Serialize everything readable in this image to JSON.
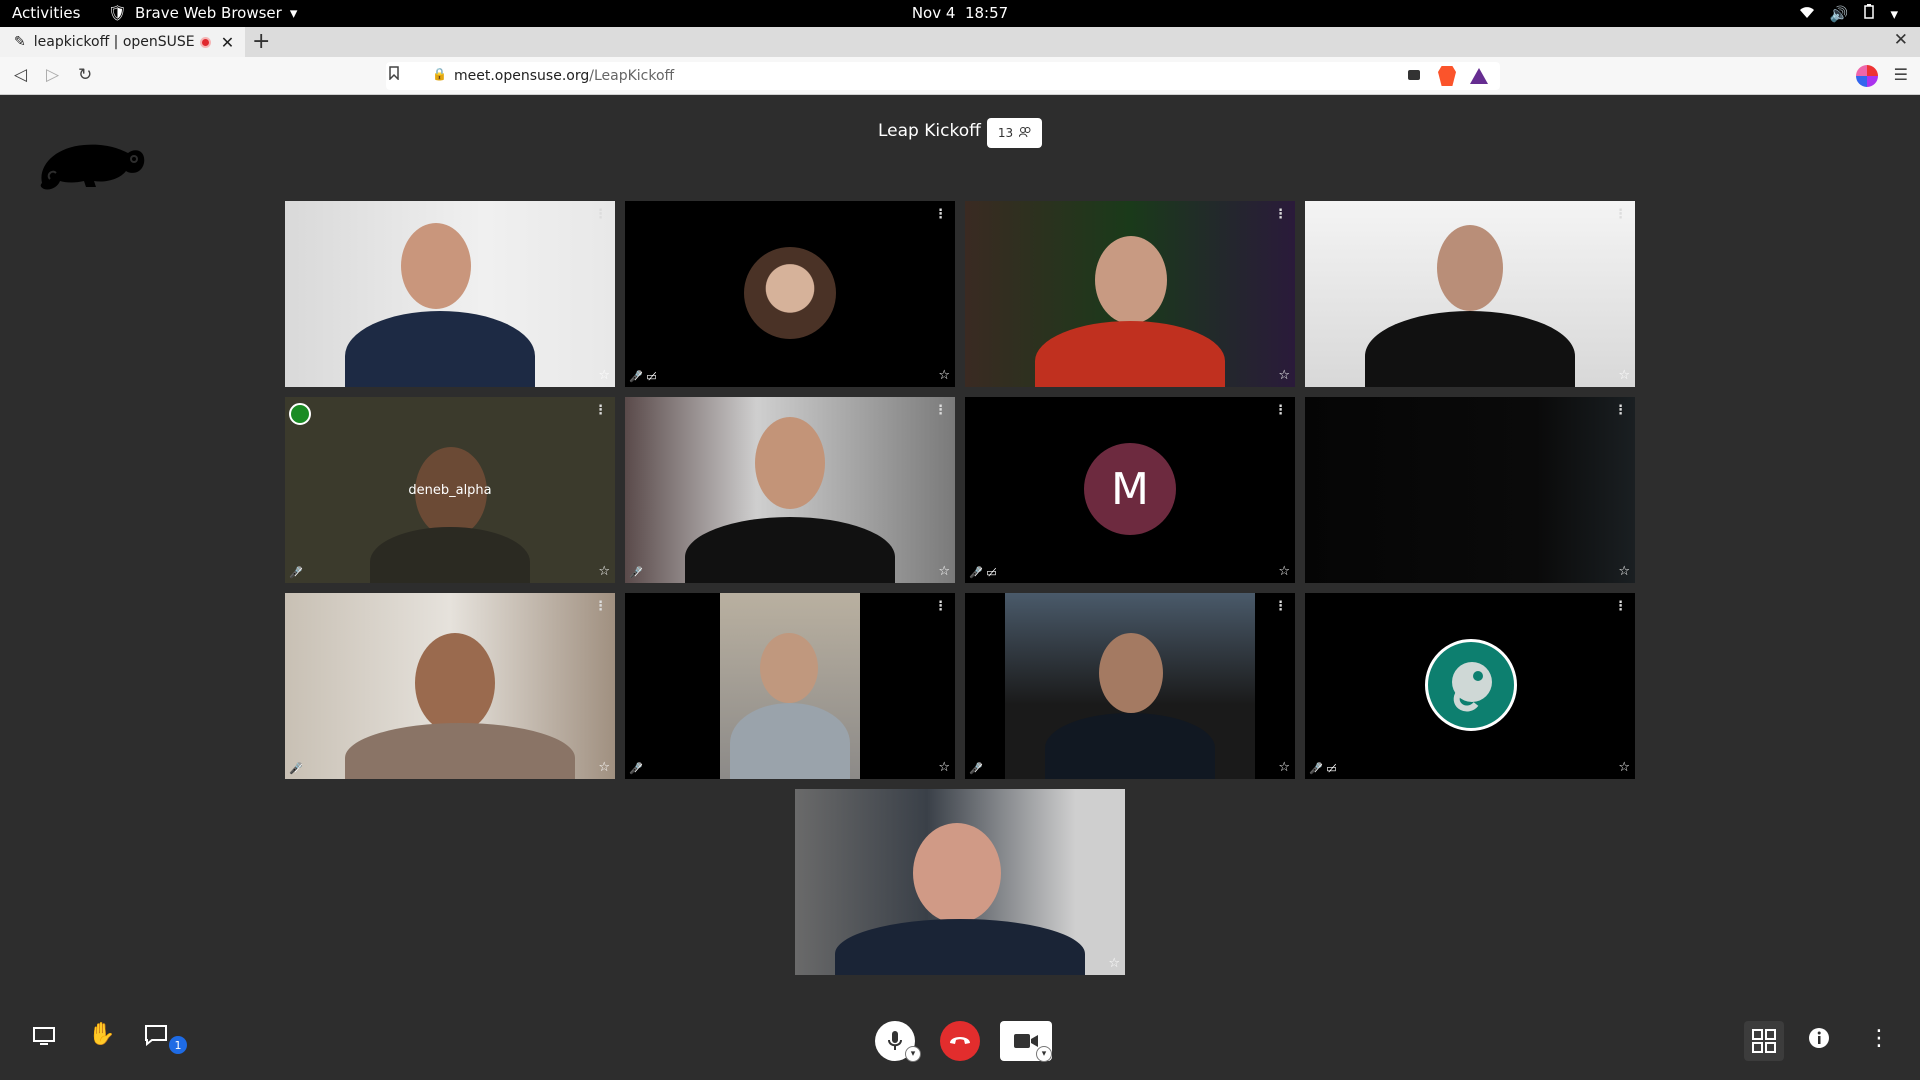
{
  "topbar": {
    "activities": "Activities",
    "app": "Brave Web Browser",
    "date": "Nov 4",
    "time": "18:57"
  },
  "browser": {
    "tab_title": "leapkickoff | openSUSE",
    "new_tab": "+",
    "close_window": "✕",
    "url_domain": "meet.opensuse.org",
    "url_path": "/LeapKickoff"
  },
  "meeting": {
    "title": "Leap Kickoff",
    "participant_count": "13",
    "participants": [
      {
        "label": ""
      },
      {
        "label": ""
      },
      {
        "label": ""
      },
      {
        "label": ""
      },
      {
        "label": "deneb_alpha"
      },
      {
        "label": ""
      },
      {
        "label": "M"
      },
      {
        "label": ""
      },
      {
        "label": ""
      },
      {
        "label": ""
      },
      {
        "label": ""
      },
      {
        "label": ""
      },
      {
        "label": ""
      }
    ]
  },
  "bottombar": {
    "chat_unread": "1"
  },
  "colors": {
    "accent": "#1e6be5",
    "hangup": "#e22d2d",
    "avatar_m": "#6d2a3f",
    "brand_green": "#0d7f6f"
  }
}
